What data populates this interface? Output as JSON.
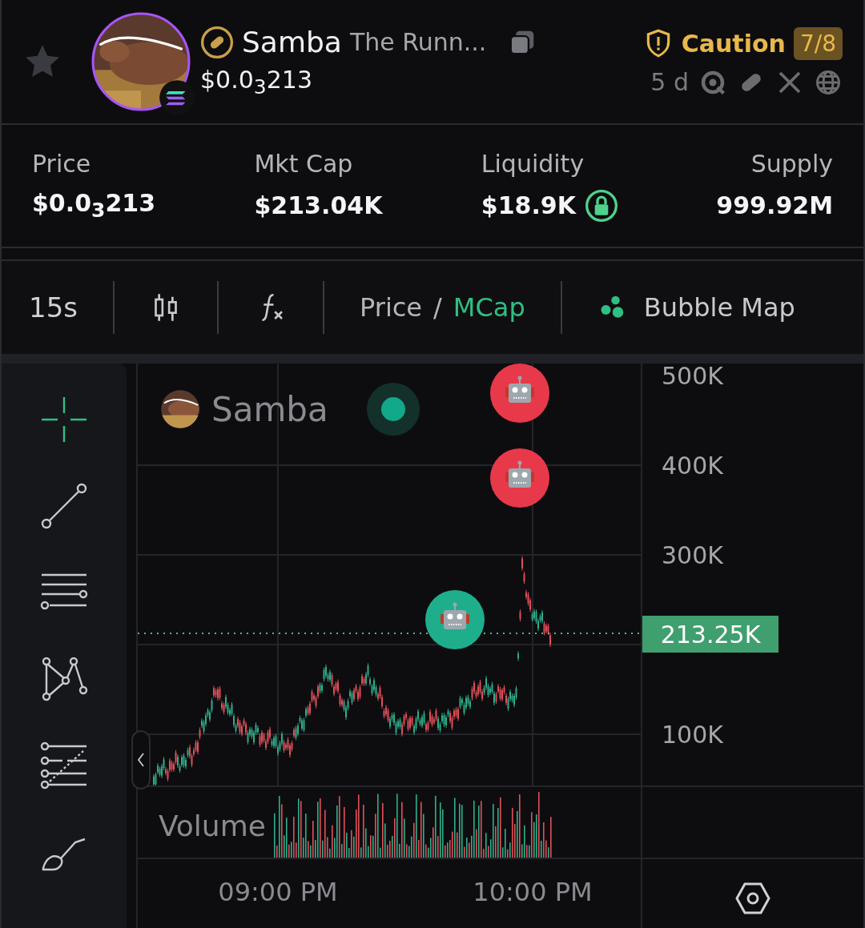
{
  "header": {
    "favorite": false,
    "name": "Samba",
    "full_name": "The Runn...",
    "price": "$0.0$_{3}$213",
    "risk": {
      "label": "Caution",
      "score": "7/8"
    },
    "age": "5 d"
  },
  "stats": [
    {
      "label": "Price",
      "value": "$0.0$_{3}$213"
    },
    {
      "label": "Mkt Cap",
      "value": "$213.04K"
    },
    {
      "label": "Liquidity",
      "value": "$18.9K",
      "locked": true
    },
    {
      "label": "Supply",
      "value": "999.92M"
    }
  ],
  "toolbar": {
    "interval": "15s",
    "modes": [
      {
        "label": "Price",
        "selected": false
      },
      {
        "label": "MCap",
        "selected": true
      }
    ],
    "separator": "/",
    "bubble_map": "Bubble Map"
  },
  "tools": [
    {
      "kind": "crosshair",
      "selected": true
    },
    {
      "kind": "trend-line",
      "selected": false
    },
    {
      "kind": "horizontal-lines",
      "selected": false
    },
    {
      "kind": "pattern",
      "selected": false
    },
    {
      "kind": "fib",
      "selected": false
    },
    {
      "kind": "brush",
      "selected": false
    }
  ],
  "chart": {
    "legend": "Samba",
    "y_ticks": [
      "500K",
      "400K",
      "300K",
      "100K"
    ],
    "last_price": "213.25K",
    "volume_label": "Volume",
    "x_ticks": [
      "09:00 PM",
      "10:00 PM"
    ],
    "markers": [
      {
        "color": "#e8394a"
      },
      {
        "color": "#e8394a"
      },
      {
        "color": "#1fae8c"
      }
    ]
  }
}
